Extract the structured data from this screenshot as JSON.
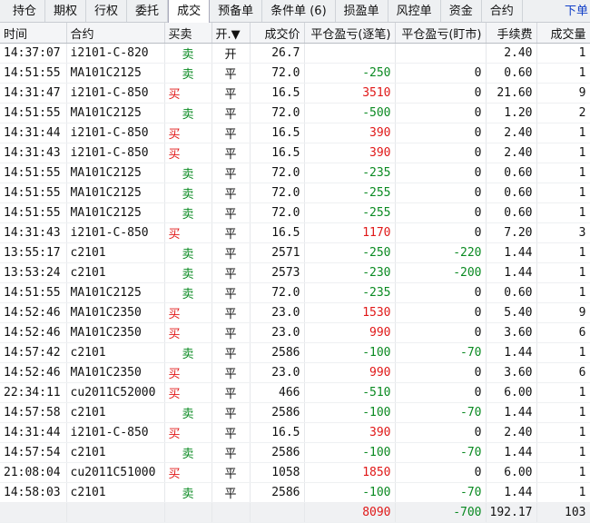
{
  "tabs": [
    "持仓",
    "期权",
    "行权",
    "委托",
    "成交",
    "预备单",
    "条件单 (6)",
    "损盈单",
    "风控单",
    "资金",
    "合约"
  ],
  "active_tab": 4,
  "order_link": "下单",
  "columns": [
    "时间",
    "合约",
    "买卖",
    "开.▼",
    "成交价",
    "平仓盈亏(逐笔)",
    "平仓盈亏(盯市)",
    "手续费",
    "成交量"
  ],
  "rows": [
    {
      "time": "14:37:07",
      "contract": "i2101-C-820",
      "side": "卖",
      "oc": "开",
      "price": "26.7",
      "pnl_trade": "",
      "pnl_mtm": "",
      "fee": "2.40",
      "qty": "1"
    },
    {
      "time": "14:51:55",
      "contract": "MA101C2125",
      "side": "卖",
      "oc": "平",
      "price": "72.0",
      "pnl_trade": "-250",
      "pnl_mtm": "0",
      "fee": "0.60",
      "qty": "1"
    },
    {
      "time": "14:31:47",
      "contract": "i2101-C-850",
      "side": "买",
      "oc": "平",
      "price": "16.5",
      "pnl_trade": "3510",
      "pnl_mtm": "0",
      "fee": "21.60",
      "qty": "9"
    },
    {
      "time": "14:51:55",
      "contract": "MA101C2125",
      "side": "卖",
      "oc": "平",
      "price": "72.0",
      "pnl_trade": "-500",
      "pnl_mtm": "0",
      "fee": "1.20",
      "qty": "2"
    },
    {
      "time": "14:31:44",
      "contract": "i2101-C-850",
      "side": "买",
      "oc": "平",
      "price": "16.5",
      "pnl_trade": "390",
      "pnl_mtm": "0",
      "fee": "2.40",
      "qty": "1"
    },
    {
      "time": "14:31:43",
      "contract": "i2101-C-850",
      "side": "买",
      "oc": "平",
      "price": "16.5",
      "pnl_trade": "390",
      "pnl_mtm": "0",
      "fee": "2.40",
      "qty": "1"
    },
    {
      "time": "14:51:55",
      "contract": "MA101C2125",
      "side": "卖",
      "oc": "平",
      "price": "72.0",
      "pnl_trade": "-235",
      "pnl_mtm": "0",
      "fee": "0.60",
      "qty": "1"
    },
    {
      "time": "14:51:55",
      "contract": "MA101C2125",
      "side": "卖",
      "oc": "平",
      "price": "72.0",
      "pnl_trade": "-255",
      "pnl_mtm": "0",
      "fee": "0.60",
      "qty": "1"
    },
    {
      "time": "14:51:55",
      "contract": "MA101C2125",
      "side": "卖",
      "oc": "平",
      "price": "72.0",
      "pnl_trade": "-255",
      "pnl_mtm": "0",
      "fee": "0.60",
      "qty": "1"
    },
    {
      "time": "14:31:43",
      "contract": "i2101-C-850",
      "side": "买",
      "oc": "平",
      "price": "16.5",
      "pnl_trade": "1170",
      "pnl_mtm": "0",
      "fee": "7.20",
      "qty": "3"
    },
    {
      "time": "13:55:17",
      "contract": "c2101",
      "side": "卖",
      "oc": "平",
      "price": "2571",
      "pnl_trade": "-250",
      "pnl_mtm": "-220",
      "fee": "1.44",
      "qty": "1"
    },
    {
      "time": "13:53:24",
      "contract": "c2101",
      "side": "卖",
      "oc": "平",
      "price": "2573",
      "pnl_trade": "-230",
      "pnl_mtm": "-200",
      "fee": "1.44",
      "qty": "1"
    },
    {
      "time": "14:51:55",
      "contract": "MA101C2125",
      "side": "卖",
      "oc": "平",
      "price": "72.0",
      "pnl_trade": "-235",
      "pnl_mtm": "0",
      "fee": "0.60",
      "qty": "1"
    },
    {
      "time": "14:52:46",
      "contract": "MA101C2350",
      "side": "买",
      "oc": "平",
      "price": "23.0",
      "pnl_trade": "1530",
      "pnl_mtm": "0",
      "fee": "5.40",
      "qty": "9"
    },
    {
      "time": "14:52:46",
      "contract": "MA101C2350",
      "side": "买",
      "oc": "平",
      "price": "23.0",
      "pnl_trade": "990",
      "pnl_mtm": "0",
      "fee": "3.60",
      "qty": "6"
    },
    {
      "time": "14:57:42",
      "contract": "c2101",
      "side": "卖",
      "oc": "平",
      "price": "2586",
      "pnl_trade": "-100",
      "pnl_mtm": "-70",
      "fee": "1.44",
      "qty": "1"
    },
    {
      "time": "14:52:46",
      "contract": "MA101C2350",
      "side": "买",
      "oc": "平",
      "price": "23.0",
      "pnl_trade": "990",
      "pnl_mtm": "0",
      "fee": "3.60",
      "qty": "6"
    },
    {
      "time": "22:34:11",
      "contract": "cu2011C52000",
      "side": "买",
      "oc": "平",
      "price": "466",
      "pnl_trade": "-510",
      "pnl_mtm": "0",
      "fee": "6.00",
      "qty": "1"
    },
    {
      "time": "14:57:58",
      "contract": "c2101",
      "side": "卖",
      "oc": "平",
      "price": "2586",
      "pnl_trade": "-100",
      "pnl_mtm": "-70",
      "fee": "1.44",
      "qty": "1"
    },
    {
      "time": "14:31:44",
      "contract": "i2101-C-850",
      "side": "买",
      "oc": "平",
      "price": "16.5",
      "pnl_trade": "390",
      "pnl_mtm": "0",
      "fee": "2.40",
      "qty": "1"
    },
    {
      "time": "14:57:54",
      "contract": "c2101",
      "side": "卖",
      "oc": "平",
      "price": "2586",
      "pnl_trade": "-100",
      "pnl_mtm": "-70",
      "fee": "1.44",
      "qty": "1"
    },
    {
      "time": "21:08:04",
      "contract": "cu2011C51000",
      "side": "买",
      "oc": "平",
      "price": "1058",
      "pnl_trade": "1850",
      "pnl_mtm": "0",
      "fee": "6.00",
      "qty": "1"
    },
    {
      "time": "14:58:03",
      "contract": "c2101",
      "side": "卖",
      "oc": "平",
      "price": "2586",
      "pnl_trade": "-100",
      "pnl_mtm": "-70",
      "fee": "1.44",
      "qty": "1"
    }
  ],
  "totals": {
    "pnl_trade": "8090",
    "pnl_mtm": "-700",
    "fee": "192.17",
    "qty": "103"
  }
}
